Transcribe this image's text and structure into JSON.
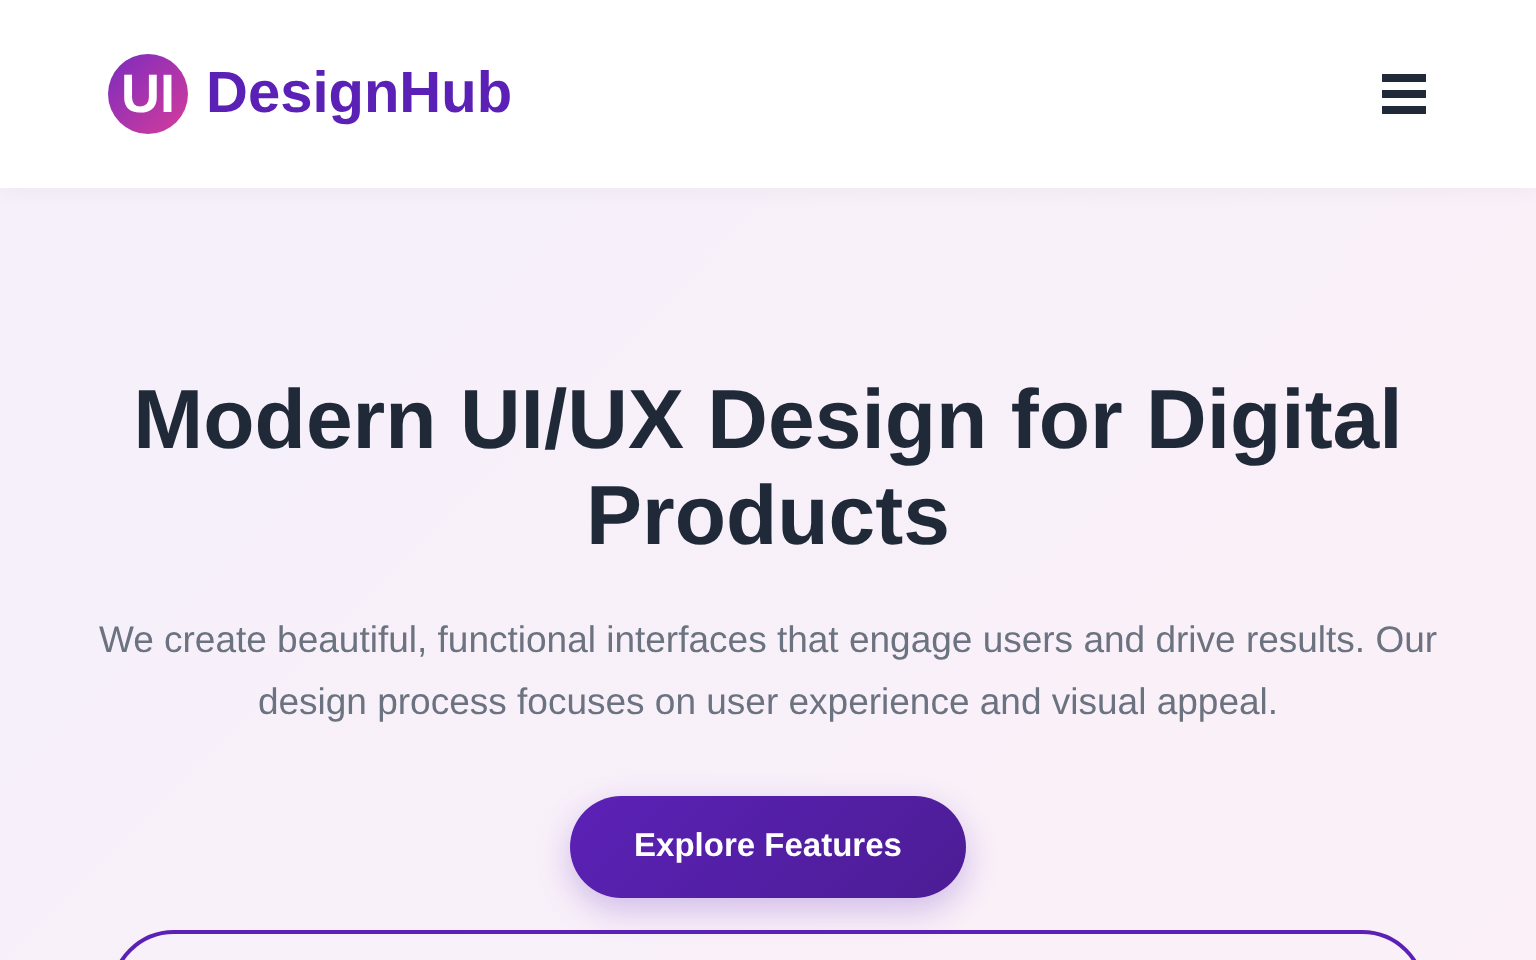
{
  "header": {
    "logo_mark": "UI",
    "brand": "DesignHub"
  },
  "hero": {
    "title": "Modern UI/UX Design for Digital Products",
    "description": "We create beautiful, functional interfaces that engage users and drive results. Our design process focuses on user experience and visual appeal.",
    "button": "Explore Features"
  }
}
